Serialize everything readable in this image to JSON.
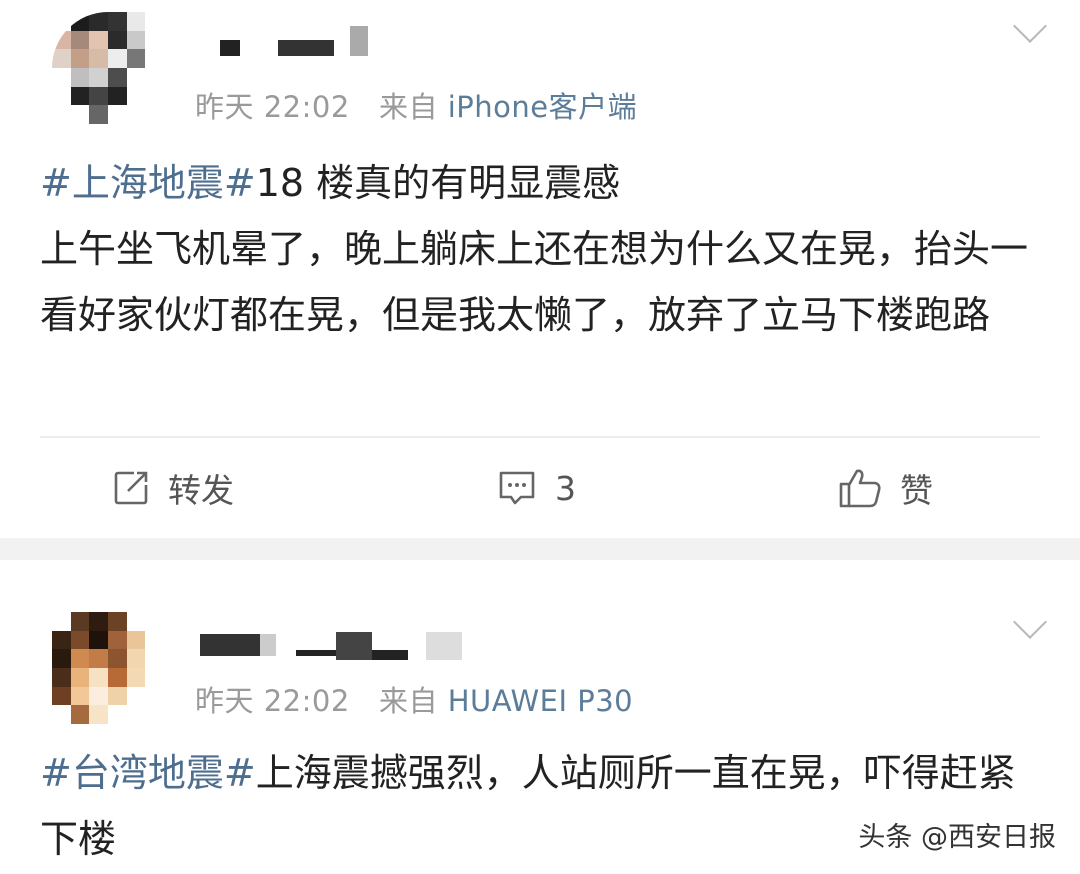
{
  "posts": [
    {
      "time": "昨天 22:02",
      "source_prefix": "来自",
      "source": "iPhone客户端",
      "hashtag": "#上海地震#",
      "text": "18 楼真的有明显震感\n上午坐飞机晕了，晚上躺床上还在想为什么又在晃，抬头一看好家伙灯都在晃，但是我太懒了，放弃了立马下楼跑路",
      "actions": {
        "repost_label": "转发",
        "comment_count": "3",
        "like_label": "赞"
      }
    },
    {
      "time": "昨天 22:02",
      "source_prefix": "来自",
      "source": "HUAWEI P30",
      "hashtag": "#台湾地震#",
      "text": "上海震撼强烈，人站厕所一直在晃，吓得赶紧下楼"
    }
  ],
  "watermark": "头条 @西安日报",
  "colors": {
    "link": "#4e6e8f",
    "meta": "#9a9a9a",
    "separator": "#f2f2f2"
  }
}
